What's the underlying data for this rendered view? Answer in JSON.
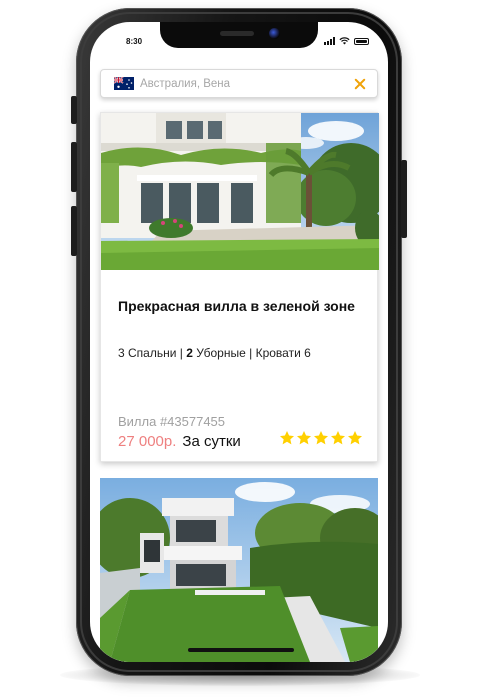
{
  "status_bar": {
    "time": "8:30"
  },
  "search": {
    "country_flag": "australia-flag",
    "value": "Австралия, Вена"
  },
  "listings": [
    {
      "title": "Прекрасная вилла в зеленой зоне",
      "bedrooms": "3 Спальни |",
      "bathrooms_count": "2",
      "bathrooms_label": "Уборные |",
      "beds": "Кровати 6",
      "id_text": "Вилла #43577455",
      "price": "27 000р.",
      "period": "За сутки",
      "rating": 5
    }
  ],
  "colors": {
    "accent": "#f0a30a",
    "price": "#ee8080",
    "star": "#ffd000"
  }
}
